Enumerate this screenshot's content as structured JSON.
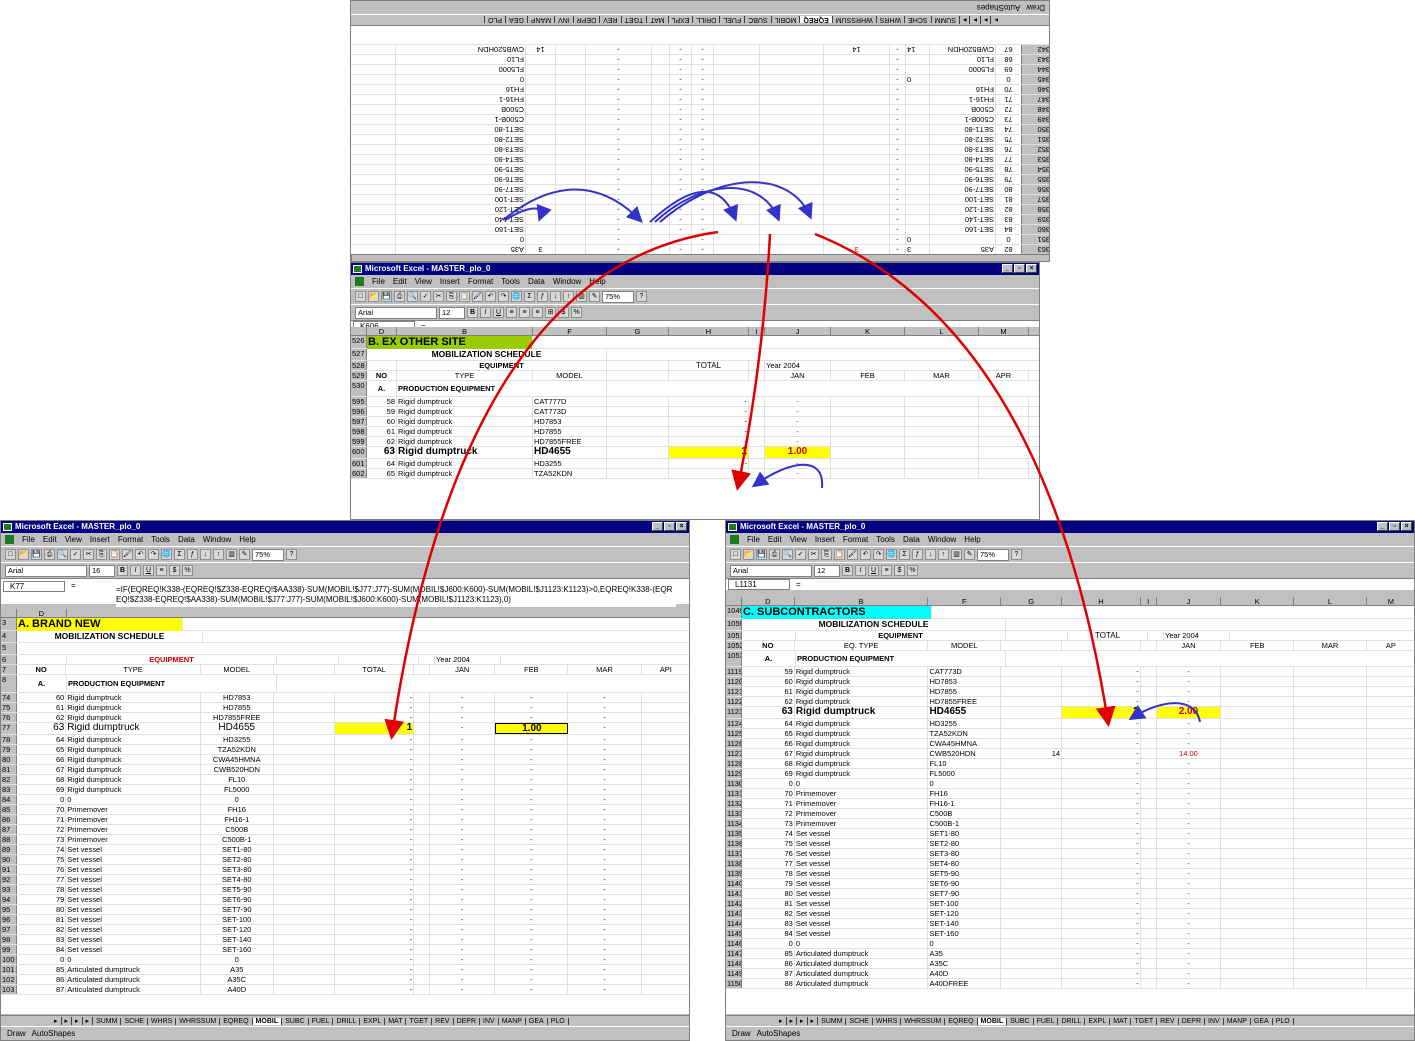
{
  "top": {
    "draw_label": "Draw",
    "autoshapes_label": "AutoShapes",
    "tabs": [
      "SUMM",
      "SCHE",
      "WHRS",
      "WHRSSUM",
      "EQREQ",
      "MOBIL",
      "SUBC",
      "FUEL",
      "DRILL",
      "EXPL",
      "MAT",
      "TGET",
      "REV",
      "DEPR",
      "INV",
      "MANP",
      "GEA",
      "PLO"
    ],
    "active_tab": "EQREQ",
    "rows": [
      {
        "n": "363",
        "a": "82",
        "b": "A35",
        "c": "3",
        "d": "3",
        "red": true
      },
      {
        "n": "351",
        "a": "0",
        "b": "",
        "c": "0",
        "d": ""
      },
      {
        "n": "360",
        "a": "84",
        "b": "SET-160",
        "c": "",
        "d": ""
      },
      {
        "n": "359",
        "a": "83",
        "b": "SET-140",
        "c": "",
        "d": ""
      },
      {
        "n": "358",
        "a": "82",
        "b": "SET-120",
        "c": "",
        "d": ""
      },
      {
        "n": "357",
        "a": "81",
        "b": "SET-100",
        "c": "",
        "d": ""
      },
      {
        "n": "356",
        "a": "80",
        "b": "SET7-90",
        "c": "",
        "d": ""
      },
      {
        "n": "355",
        "a": "79",
        "b": "SET6-90",
        "c": "",
        "d": ""
      },
      {
        "n": "354",
        "a": "78",
        "b": "SET5-90",
        "c": "",
        "d": ""
      },
      {
        "n": "353",
        "a": "77",
        "b": "SET4-80",
        "c": "",
        "d": ""
      },
      {
        "n": "352",
        "a": "76",
        "b": "SET3-80",
        "c": "",
        "d": ""
      },
      {
        "n": "351",
        "a": "75",
        "b": "SET2-80",
        "c": "",
        "d": ""
      },
      {
        "n": "350",
        "a": "74",
        "b": "SET1-80",
        "c": "",
        "d": ""
      },
      {
        "n": "349",
        "a": "73",
        "b": "C500B-1",
        "c": "",
        "d": ""
      },
      {
        "n": "348",
        "a": "72",
        "b": "C500B",
        "c": "",
        "d": ""
      },
      {
        "n": "347",
        "a": "71",
        "b": "FH16-1",
        "c": "",
        "d": ""
      },
      {
        "n": "346",
        "a": "70",
        "b": "FH16",
        "c": "",
        "d": ""
      },
      {
        "n": "345",
        "a": "0",
        "b": "",
        "c": "0",
        "d": ""
      },
      {
        "n": "344",
        "a": "69",
        "b": "FL5000",
        "c": "",
        "d": ""
      },
      {
        "n": "343",
        "a": "68",
        "b": "FL10",
        "c": "",
        "d": ""
      },
      {
        "n": "342",
        "a": "67",
        "b": "CWB520HDN",
        "c": "14",
        "d": "14"
      }
    ],
    "right_values": [
      "A35",
      "0",
      "SET-160",
      "SET-140",
      "SET-120",
      "SET-100",
      "SET7-90",
      "SET6-90",
      "SET5-90",
      "SET4-80",
      "SET3-80",
      "SET2-80",
      "SET1-80",
      "C500B-1",
      "C500B",
      "FH16-1",
      "FH16",
      "0",
      "FL5000",
      "FL10",
      "CWB520HDN"
    ]
  },
  "middle": {
    "title": "Microsoft Excel - MASTER_plo_0",
    "menu": [
      "File",
      "Edit",
      "View",
      "Insert",
      "Format",
      "Tools",
      "Data",
      "Window",
      "Help"
    ],
    "zoom": "75%",
    "font": "Arial",
    "font_size": "12",
    "namebox": "K606",
    "cols": [
      "D",
      "B",
      "F",
      "G",
      "H",
      "I",
      "J",
      "K",
      "L",
      "M"
    ],
    "section": "B.  EX OTHER SITE",
    "schedule": "MOBILIZATION  SCHEDULE",
    "no": "NO",
    "equipment": "EQUIPMENT",
    "type": "TYPE",
    "model": "MODEL",
    "total": "TOTAL",
    "year": "Year 2004",
    "months": [
      "JAN",
      "FEB",
      "MAR",
      "APR"
    ],
    "cat_a": "A.",
    "prod": "PRODUCTION EQUIPMENT",
    "hdr_rows": [
      "526",
      "527",
      "528",
      "529",
      "530",
      "531",
      "532",
      "533"
    ],
    "rows": [
      {
        "n": "595",
        "no": "58",
        "t": "Rigid dumptruck",
        "m": "CAT777D",
        "tot": "-",
        "j": "-"
      },
      {
        "n": "596",
        "no": "59",
        "t": "Rigid dumptruck",
        "m": "CAT773D",
        "tot": "-",
        "j": "-"
      },
      {
        "n": "597",
        "no": "60",
        "t": "Rigid dumptruck",
        "m": "HD7853",
        "tot": "-",
        "j": "-"
      },
      {
        "n": "598",
        "no": "61",
        "t": "Rigid dumptruck",
        "m": "HD7855",
        "tot": "-",
        "j": "-"
      },
      {
        "n": "599",
        "no": "62",
        "t": "Rigid dumptruck",
        "m": "HD7855FREE",
        "tot": "-",
        "j": "-"
      },
      {
        "n": "600",
        "no": "63",
        "t": "Rigid dumptruck",
        "m": "HD4655",
        "tot": "1",
        "j": "1.00",
        "hl": true
      },
      {
        "n": "601",
        "no": "64",
        "t": "Rigid dumptruck",
        "m": "HD3255",
        "tot": "-",
        "j": "-"
      },
      {
        "n": "602",
        "no": "65",
        "t": "Rigid dumptruck",
        "m": "TZA52KDN",
        "tot": "-",
        "j": "-"
      }
    ]
  },
  "left": {
    "title": "Microsoft Excel - MASTER_plo_0",
    "menu": [
      "File",
      "Edit",
      "View",
      "Insert",
      "Format",
      "Tools",
      "Data",
      "Window",
      "Help"
    ],
    "zoom": "75%",
    "font": "Arial",
    "font_size": "16",
    "namebox": "K77",
    "formula": "=IF(EQREQ!K338-(EQREQ!$Z338-EQREQ!$AA338)-SUM(MOBIL!$J77:J77)-SUM(MOBIL!$J600:K600)-SUM(MOBIL!$J1123:K1123)>0,EQREQ!K338-(EQREQ!$Z338-EQREQ!$AA338)-SUM(MOBIL!$J77:J77)-SUM(MOBIL!$J600:K600)-SUM(MOBIL!$J1123:K1123),0)",
    "section": "A.  BRAND  NEW",
    "schedule": "MOBILIZATION  SCHEDULE",
    "no": "NO",
    "equipment": "EQUIPMENT",
    "type": "TYPE",
    "model": "MODEL",
    "total": "TOTAL",
    "year": "Year 2004",
    "months": [
      "JAN",
      "FEB",
      "MAR",
      "API"
    ],
    "cat_a": "A.",
    "prod": "PRODUCTION EQUIPMENT",
    "col_d": "D",
    "hdr_rows": [
      "3",
      "4",
      "5",
      "6",
      "7",
      "8",
      "9",
      "10"
    ],
    "rows": [
      {
        "n": "74",
        "no": "60",
        "t": "Rigid dumptruck",
        "m": "HD7853",
        "tot": "-",
        "j": "-",
        "f": "-"
      },
      {
        "n": "75",
        "no": "61",
        "t": "Rigid dumptruck",
        "m": "HD7855",
        "tot": "-",
        "j": "-",
        "f": "-"
      },
      {
        "n": "76",
        "no": "62",
        "t": "Rigid dumptruck",
        "m": "HD7855FREE",
        "tot": "-",
        "j": "-",
        "f": "-"
      },
      {
        "n": "77",
        "no": "63",
        "t": "Rigid dumptruck",
        "m": "HD4655",
        "tot": "1",
        "j": "-",
        "f": "1.00",
        "hl": true
      },
      {
        "n": "78",
        "no": "64",
        "t": "Rigid dumptruck",
        "m": "HD3255",
        "tot": "-",
        "j": "-",
        "f": "-"
      },
      {
        "n": "79",
        "no": "65",
        "t": "Rigid dumptruck",
        "m": "TZA52KDN",
        "tot": "-",
        "j": "-",
        "f": "-"
      },
      {
        "n": "80",
        "no": "66",
        "t": "Rigid dumptruck",
        "m": "CWA45HMNA",
        "tot": "-",
        "j": "-",
        "f": "-"
      },
      {
        "n": "81",
        "no": "67",
        "t": "Rigid dumptruck",
        "m": "CWB520HDN",
        "tot": "-",
        "j": "-",
        "f": "-"
      },
      {
        "n": "82",
        "no": "68",
        "t": "Rigid dumptruck",
        "m": "FL10",
        "tot": "-",
        "j": "-",
        "f": "-"
      },
      {
        "n": "83",
        "no": "69",
        "t": "Rigid dumptruck",
        "m": "FL5000",
        "tot": "-",
        "j": "-",
        "f": "-"
      },
      {
        "n": "84",
        "no": "0",
        "t": "0",
        "m": "0",
        "tot": "-",
        "j": "-",
        "f": "-"
      },
      {
        "n": "85",
        "no": "70",
        "t": "Primemover",
        "m": "FH16",
        "tot": "-",
        "j": "-",
        "f": "-"
      },
      {
        "n": "86",
        "no": "71",
        "t": "Primemover",
        "m": "FH16-1",
        "tot": "-",
        "j": "-",
        "f": "-"
      },
      {
        "n": "87",
        "no": "72",
        "t": "Primemover",
        "m": "C500B",
        "tot": "-",
        "j": "-",
        "f": "-"
      },
      {
        "n": "88",
        "no": "73",
        "t": "Primemover",
        "m": "C500B-1",
        "tot": "-",
        "j": "-",
        "f": "-"
      },
      {
        "n": "89",
        "no": "74",
        "t": "Set vessel",
        "m": "SET1-80",
        "tot": "-",
        "j": "-",
        "f": "-"
      },
      {
        "n": "90",
        "no": "75",
        "t": "Set vessel",
        "m": "SET2-80",
        "tot": "-",
        "j": "-",
        "f": "-"
      },
      {
        "n": "91",
        "no": "76",
        "t": "Set vessel",
        "m": "SET3-80",
        "tot": "-",
        "j": "-",
        "f": "-"
      },
      {
        "n": "92",
        "no": "77",
        "t": "Set vessel",
        "m": "SET4-80",
        "tot": "-",
        "j": "-",
        "f": "-"
      },
      {
        "n": "93",
        "no": "78",
        "t": "Set vessel",
        "m": "SET5-90",
        "tot": "-",
        "j": "-",
        "f": "-"
      },
      {
        "n": "94",
        "no": "79",
        "t": "Set vessel",
        "m": "SET6-90",
        "tot": "-",
        "j": "-",
        "f": "-"
      },
      {
        "n": "95",
        "no": "80",
        "t": "Set vessel",
        "m": "SET7-90",
        "tot": "-",
        "j": "-",
        "f": "-"
      },
      {
        "n": "96",
        "no": "81",
        "t": "Set vessel",
        "m": "SET-100",
        "tot": "-",
        "j": "-",
        "f": "-"
      },
      {
        "n": "97",
        "no": "82",
        "t": "Set vessel",
        "m": "SET-120",
        "tot": "-",
        "j": "-",
        "f": "-"
      },
      {
        "n": "98",
        "no": "83",
        "t": "Set vessel",
        "m": "SET-140",
        "tot": "-",
        "j": "-",
        "f": "-"
      },
      {
        "n": "99",
        "no": "84",
        "t": "Set vessel",
        "m": "SET-160",
        "tot": "-",
        "j": "-",
        "f": "-"
      },
      {
        "n": "100",
        "no": "0",
        "t": "0",
        "m": "0",
        "tot": "-",
        "j": "-",
        "f": "-"
      },
      {
        "n": "101",
        "no": "85",
        "t": "Articulated dumptruck",
        "m": "A35",
        "tot": "-",
        "j": "-",
        "f": "-"
      },
      {
        "n": "102",
        "no": "86",
        "t": "Articulated dumptruck",
        "m": "A35C",
        "tot": "-",
        "j": "-",
        "f": "-"
      },
      {
        "n": "103",
        "no": "87",
        "t": "Articulated dumptruck",
        "m": "A40D",
        "tot": "-",
        "j": "-",
        "f": "-"
      }
    ],
    "tabs": [
      "SUMM",
      "SCHE",
      "WHRS",
      "WHRSSUM",
      "EQREQ",
      "MOBIL",
      "SUBC",
      "FUEL",
      "DRILL",
      "EXPL",
      "MAT",
      "TGET",
      "REV",
      "DEPR",
      "INV",
      "MANP",
      "GEA",
      "PLO"
    ],
    "active_tab": "MOBIL",
    "draw_label": "Draw",
    "autoshapes_label": "AutoShapes"
  },
  "right": {
    "title": "Microsoft Excel - MASTER_plo_0",
    "menu": [
      "File",
      "Edit",
      "View",
      "Insert",
      "Format",
      "Tools",
      "Data",
      "Window",
      "Help"
    ],
    "zoom": "75%",
    "font": "Arial",
    "font_size": "12",
    "namebox": "L1131",
    "cols": [
      "D",
      "B",
      "F",
      "G",
      "H",
      "I",
      "J",
      "K",
      "L",
      "M"
    ],
    "section": "C.  SUBCONTRACTORS",
    "schedule": "MOBILIZATION  SCHEDULE",
    "no": "NO",
    "equipment": "EQUIPMENT",
    "type": "EQ. TYPE",
    "model": "MODEL",
    "total": "TOTAL",
    "year": "Year 2004",
    "months": [
      "JAN",
      "FEB",
      "MAR",
      "AP"
    ],
    "cat_a": "A.",
    "prod": "PRODUCTION EQUIPMENT",
    "hdr_rows": [
      "1049",
      "1050",
      "1051",
      "1052",
      "1053",
      "1054",
      "1055"
    ],
    "rows": [
      {
        "n": "1119",
        "no": "59",
        "t": "Rigid dumptruck",
        "m": "CAT773D",
        "g": "",
        "tot": "-",
        "j": "-"
      },
      {
        "n": "1120",
        "no": "60",
        "t": "Rigid dumptruck",
        "m": "HD7853",
        "g": "",
        "tot": "-",
        "j": "-"
      },
      {
        "n": "1121",
        "no": "61",
        "t": "Rigid dumptruck",
        "m": "HD7855",
        "g": "",
        "tot": "-",
        "j": "-"
      },
      {
        "n": "1122",
        "no": "62",
        "t": "Rigid dumptruck",
        "m": "HD7855FREE",
        "g": "",
        "tot": "-",
        "j": "-"
      },
      {
        "n": "1123",
        "no": "63",
        "t": "Rigid dumptruck",
        "m": "HD4655",
        "g": "",
        "tot": "2",
        "j": "2.00",
        "hl": true
      },
      {
        "n": "1124",
        "no": "64",
        "t": "Rigid dumptruck",
        "m": "HD3255",
        "g": "",
        "tot": "-",
        "j": "-"
      },
      {
        "n": "1125",
        "no": "65",
        "t": "Rigid dumptruck",
        "m": "TZA52KDN",
        "g": "",
        "tot": "-",
        "j": "-"
      },
      {
        "n": "1126",
        "no": "66",
        "t": "Rigid dumptruck",
        "m": "CWA45HMNA",
        "g": "",
        "tot": "-",
        "j": "-"
      },
      {
        "n": "1127",
        "no": "67",
        "t": "Rigid dumptruck",
        "m": "CWB520HDN",
        "g": "14",
        "tot": "-",
        "j": "14.00"
      },
      {
        "n": "1128",
        "no": "68",
        "t": "Rigid dumptruck",
        "m": "FL10",
        "g": "",
        "tot": "-",
        "j": "-"
      },
      {
        "n": "1129",
        "no": "69",
        "t": "Rigid dumptruck",
        "m": "FL5000",
        "g": "",
        "tot": "-",
        "j": "-"
      },
      {
        "n": "1130",
        "no": "0",
        "t": "0",
        "m": "0",
        "g": "",
        "tot": "-",
        "j": "-"
      },
      {
        "n": "1131",
        "no": "70",
        "t": "Primemover",
        "m": "FH16",
        "g": "",
        "tot": "-",
        "j": "-"
      },
      {
        "n": "1132",
        "no": "71",
        "t": "Primemover",
        "m": "FH16-1",
        "g": "",
        "tot": "-",
        "j": "-"
      },
      {
        "n": "1133",
        "no": "72",
        "t": "Primemover",
        "m": "C500B",
        "g": "",
        "tot": "-",
        "j": "-"
      },
      {
        "n": "1134",
        "no": "73",
        "t": "Primemover",
        "m": "C500B-1",
        "g": "",
        "tot": "-",
        "j": "-"
      },
      {
        "n": "1135",
        "no": "74",
        "t": "Set vessel",
        "m": "SET1-80",
        "g": "",
        "tot": "-",
        "j": "-"
      },
      {
        "n": "1136",
        "no": "75",
        "t": "Set vessel",
        "m": "SET2-80",
        "g": "",
        "tot": "-",
        "j": "-"
      },
      {
        "n": "1137",
        "no": "76",
        "t": "Set vessel",
        "m": "SET3-80",
        "g": "",
        "tot": "-",
        "j": "-"
      },
      {
        "n": "1138",
        "no": "77",
        "t": "Set vessel",
        "m": "SET4-80",
        "g": "",
        "tot": "-",
        "j": "-"
      },
      {
        "n": "1139",
        "no": "78",
        "t": "Set vessel",
        "m": "SET5-90",
        "g": "",
        "tot": "-",
        "j": "-"
      },
      {
        "n": "1140",
        "no": "79",
        "t": "Set vessel",
        "m": "SET6-90",
        "g": "",
        "tot": "-",
        "j": "-"
      },
      {
        "n": "1141",
        "no": "80",
        "t": "Set vessel",
        "m": "SET7-90",
        "g": "",
        "tot": "-",
        "j": "-"
      },
      {
        "n": "1142",
        "no": "81",
        "t": "Set vessel",
        "m": "SET-100",
        "g": "",
        "tot": "-",
        "j": "-"
      },
      {
        "n": "1143",
        "no": "82",
        "t": "Set vessel",
        "m": "SET-120",
        "g": "",
        "tot": "-",
        "j": "-"
      },
      {
        "n": "1144",
        "no": "83",
        "t": "Set vessel",
        "m": "SET-140",
        "g": "",
        "tot": "-",
        "j": "-"
      },
      {
        "n": "1145",
        "no": "84",
        "t": "Set vessel",
        "m": "SET-160",
        "g": "",
        "tot": "-",
        "j": "-"
      },
      {
        "n": "1146",
        "no": "0",
        "t": "0",
        "m": "0",
        "g": "",
        "tot": "-",
        "j": "-"
      },
      {
        "n": "1147",
        "no": "85",
        "t": "Articulated dumptruck",
        "m": "A35",
        "g": "",
        "tot": "-",
        "j": "-"
      },
      {
        "n": "1148",
        "no": "86",
        "t": "Articulated dumptruck",
        "m": "A35C",
        "g": "",
        "tot": "-",
        "j": "-"
      },
      {
        "n": "1149",
        "no": "87",
        "t": "Articulated dumptruck",
        "m": "A40D",
        "g": "",
        "tot": "-",
        "j": "-"
      },
      {
        "n": "1150",
        "no": "88",
        "t": "Articulated dumptruck",
        "m": "A40DFREE",
        "g": "",
        "tot": "-",
        "j": "-"
      }
    ],
    "tabs": [
      "SUMM",
      "SCHE",
      "WHRS",
      "WHRSSUM",
      "EQREQ",
      "MOBIL",
      "SUBC",
      "FUEL",
      "DRILL",
      "EXPL",
      "MAT",
      "TGET",
      "REV",
      "DEPR",
      "INV",
      "MANP",
      "GEA",
      "PLO"
    ],
    "active_tab": "MOBIL",
    "draw_label": "Draw",
    "autoshapes_label": "AutoShapes"
  },
  "colors": {
    "section_green": "#99cc00",
    "section_yellow": "#ffff00",
    "section_cyan": "#00ffff",
    "title_blue": "#000080",
    "arrow_red": "#e00000",
    "arrow_blue": "#3333cc"
  }
}
